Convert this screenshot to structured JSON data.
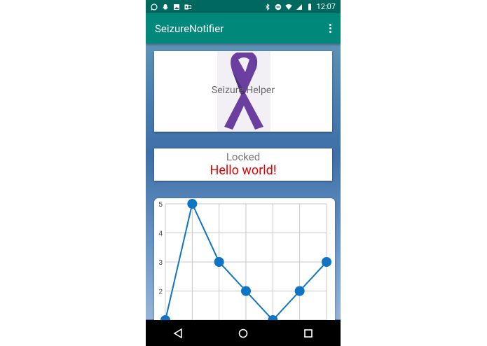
{
  "status_bar": {
    "time": "12:07",
    "left_icons": [
      "whatsapp-icon",
      "snapchat-icon",
      "image-icon",
      "outlook-icon"
    ],
    "right_icons": [
      "bluetooth-icon",
      "do-not-disturb-icon",
      "wifi-icon",
      "signal-icon",
      "battery-icon"
    ]
  },
  "app_bar": {
    "title": "SeizureNotifier",
    "overflow_icon": "more-vert-icon"
  },
  "helper_card": {
    "label": "Seizure Helper",
    "image": "purple-awareness-ribbon",
    "ribbon_color": "#6a3fa0"
  },
  "status_card": {
    "locked_label": "Locked",
    "message": "Hello world!",
    "message_color": "#e00000"
  },
  "chart_data": {
    "type": "line",
    "x": [
      0,
      1,
      2,
      3,
      4,
      5,
      6
    ],
    "values": [
      1,
      5,
      3,
      2,
      1,
      2,
      3
    ],
    "y_ticks": [
      "5",
      "4",
      "3",
      "2"
    ],
    "ylim": [
      1,
      5
    ],
    "grid": true,
    "line_color": "#0e74c4"
  },
  "nav_bar": {
    "buttons": [
      "back-icon",
      "home-icon",
      "recents-icon"
    ]
  }
}
